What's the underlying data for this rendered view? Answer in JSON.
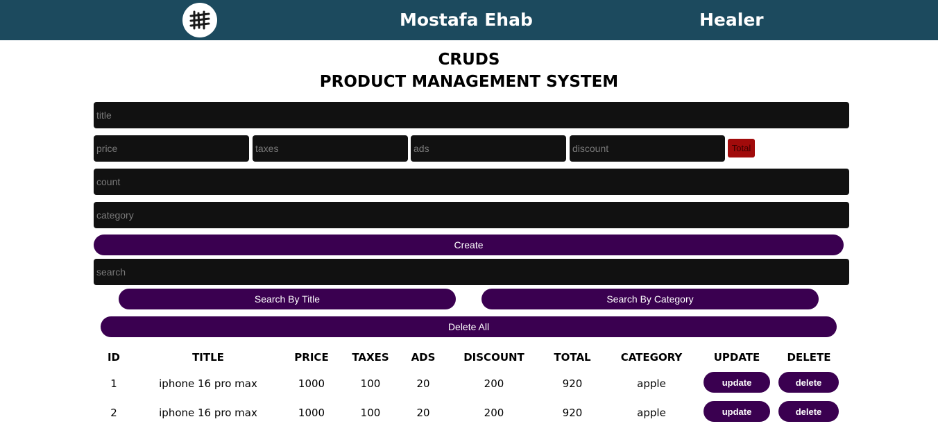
{
  "header": {
    "name": "Mostafa Ehab",
    "role": "Healer",
    "logo_icon": "hm-monogram-logo-icon",
    "bg_color": "#1c4a5e"
  },
  "page": {
    "title": "CRUDS",
    "subtitle": "PRODUCT MANAGEMENT SYSTEM"
  },
  "form": {
    "title_placeholder": "title",
    "price_placeholder": "price",
    "taxes_placeholder": "taxes",
    "ads_placeholder": "ads",
    "discount_placeholder": "discount",
    "total_label": "Total",
    "count_placeholder": "count",
    "category_placeholder": "category",
    "create_label": "Create",
    "search_placeholder": "search",
    "search_title_label": "Search By Title",
    "search_category_label": "Search By Category",
    "delete_all_label": "Delete All"
  },
  "colors": {
    "accent": "#3a0050",
    "input_bg": "#111111",
    "total_bg": "#a10b0b"
  },
  "table": {
    "headers": [
      "ID",
      "TITLE",
      "PRICE",
      "TAXES",
      "ADS",
      "DISCOUNT",
      "TOTAL",
      "CATEGORY",
      "UPDATE",
      "DELETE"
    ],
    "rows": [
      {
        "id": "1",
        "title": "iphone 16 pro max",
        "price": "1000",
        "taxes": "100",
        "ads": "20",
        "discount": "200",
        "total": "920",
        "category": "apple",
        "update": "update",
        "delete": "delete"
      },
      {
        "id": "2",
        "title": "iphone 16 pro max",
        "price": "1000",
        "taxes": "100",
        "ads": "20",
        "discount": "200",
        "total": "920",
        "category": "apple",
        "update": "update",
        "delete": "delete"
      }
    ]
  }
}
